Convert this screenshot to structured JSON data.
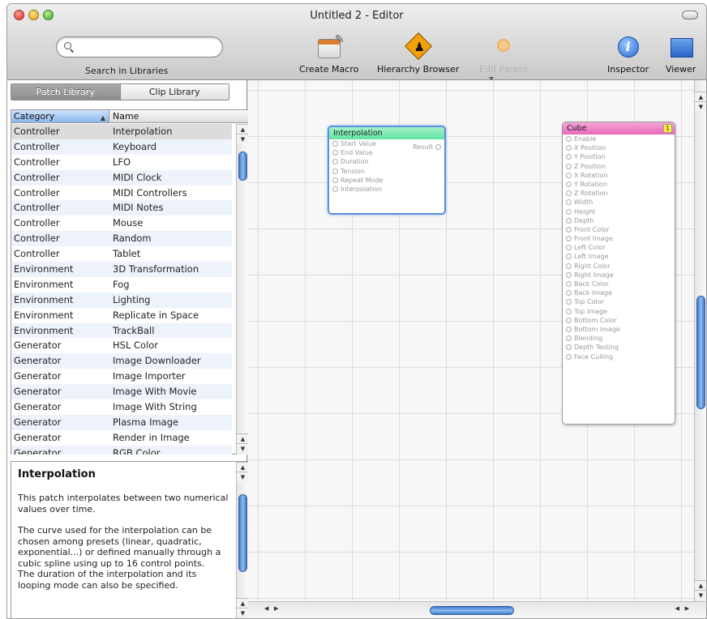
{
  "window": {
    "title": "Untitled 2 - Editor"
  },
  "toolbar": {
    "search_placeholder": "",
    "search_label": "Search in Libraries",
    "create_macro": "Create Macro",
    "hierarchy_browser": "Hierarchy Browser",
    "edit_parent": "Edit Parent",
    "inspector": "Inspector",
    "viewer": "Viewer"
  },
  "library": {
    "tabs": [
      "Patch Library",
      "Clip Library"
    ],
    "selected_tab": "Patch Library",
    "columns": [
      "Category",
      "Name"
    ],
    "rows": [
      {
        "category": "Controller",
        "name": "Interpolation"
      },
      {
        "category": "Controller",
        "name": "Keyboard"
      },
      {
        "category": "Controller",
        "name": "LFO"
      },
      {
        "category": "Controller",
        "name": "MIDI Clock"
      },
      {
        "category": "Controller",
        "name": "MIDI Controllers"
      },
      {
        "category": "Controller",
        "name": "MIDI Notes"
      },
      {
        "category": "Controller",
        "name": "Mouse"
      },
      {
        "category": "Controller",
        "name": "Random"
      },
      {
        "category": "Controller",
        "name": "Tablet"
      },
      {
        "category": "Environment",
        "name": "3D Transformation"
      },
      {
        "category": "Environment",
        "name": "Fog"
      },
      {
        "category": "Environment",
        "name": "Lighting"
      },
      {
        "category": "Environment",
        "name": "Replicate in Space"
      },
      {
        "category": "Environment",
        "name": "TrackBall"
      },
      {
        "category": "Generator",
        "name": "HSL Color"
      },
      {
        "category": "Generator",
        "name": "Image Downloader"
      },
      {
        "category": "Generator",
        "name": "Image Importer"
      },
      {
        "category": "Generator",
        "name": "Image With Movie"
      },
      {
        "category": "Generator",
        "name": "Image With String"
      },
      {
        "category": "Generator",
        "name": "Plasma Image"
      },
      {
        "category": "Generator",
        "name": "Render in Image"
      },
      {
        "category": "Generator",
        "name": "RGB Color"
      }
    ],
    "selected_index": 0
  },
  "description": {
    "title": "Interpolation",
    "p1": "This patch interpolates between two numerical values over time.",
    "p2": "The curve used for the interpolation can be chosen among presets (linear, quadratic, exponential...) or defined manually through a cubic spline using up to 16 control points.",
    "p3": "The duration of the interpolation and its looping mode can also be specified."
  },
  "patches": {
    "interpolation": {
      "title": "Interpolation",
      "inputs": [
        "Start Value",
        "End Value",
        "Duration",
        "Tension",
        "Repeat Mode",
        "Interpolation"
      ],
      "output": "Result",
      "color": "#5fe3a3"
    },
    "cube": {
      "title": "Cube",
      "badge": "1",
      "inputs": [
        "Enable",
        "X Position",
        "Y Position",
        "Z Position",
        "X Rotation",
        "Y Rotation",
        "Z Rotation",
        "Width",
        "Height",
        "Depth",
        "Front Color",
        "Front Image",
        "Left Color",
        "Left Image",
        "Right Color",
        "Right Image",
        "Back Color",
        "Back Image",
        "Top Color",
        "Top Image",
        "Bottom Color",
        "Bottom Image",
        "Blending",
        "Depth Testing",
        "Face Culling"
      ],
      "color": "#e868b9"
    }
  }
}
